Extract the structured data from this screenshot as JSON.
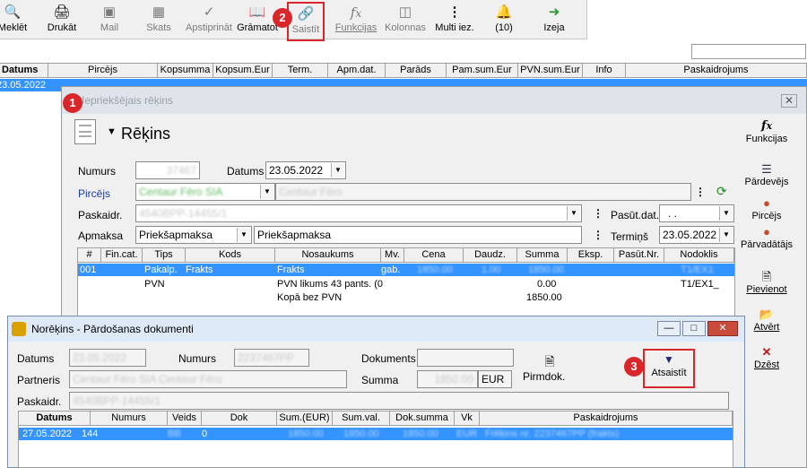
{
  "toolbar": {
    "items": [
      {
        "label": "Meklēt",
        "icon": "search-icon",
        "disabled": false
      },
      {
        "label": "Drukāt",
        "icon": "printer-icon",
        "disabled": false
      },
      {
        "label": "Mail",
        "icon": "mail-icon",
        "disabled": true
      },
      {
        "label": "Skats",
        "icon": "grid-view-icon",
        "disabled": true
      },
      {
        "label": "Apstiprināt",
        "icon": "approve-icon",
        "disabled": true
      },
      {
        "label": "Grāmatot",
        "icon": "book-icon",
        "disabled": false
      },
      {
        "label": "Saistīt",
        "icon": "link-icon",
        "disabled": true
      },
      {
        "label": "Funkcijas",
        "icon": "function-icon",
        "disabled": true
      },
      {
        "label": "Kolonnas",
        "icon": "columns-icon",
        "disabled": true
      },
      {
        "label": "Multi iez.",
        "icon": "more-icon",
        "disabled": false
      },
      {
        "label": "(10)",
        "icon": "alarm-bell-icon",
        "disabled": false
      },
      {
        "label": "Izeja",
        "icon": "exit-icon",
        "disabled": false
      }
    ]
  },
  "annotations": [
    "1",
    "2",
    "3"
  ],
  "main_grid": {
    "columns": [
      "Datums",
      "Pircējs",
      "Kopsumma",
      "Kopsum.Eur",
      "Term.",
      "Apm.dat.",
      "Parāds",
      "Pam.sum.Eur",
      "PVN.sum.Eur",
      "Info",
      "Paskaidrojums"
    ],
    "row": {
      "date": "23.05.2022"
    }
  },
  "invoice_window": {
    "title": "Iepriekšējais rēķins",
    "heading": "Rēķins",
    "functions_label": "Funkcijas",
    "fields": {
      "numurs_label": "Numurs",
      "numurs_value": "37467",
      "datums_label": "Datums",
      "datums_value": "23.05.2022",
      "pircejs_label": "Pircējs",
      "pircejs_code": "Centaur Fēro SIA",
      "pircejs_name": "Centaur Fēro",
      "paskaidr_label": "Paskaidr.",
      "paskaidr_value": "4540BPP-14455/1",
      "pasut_dat_label": "Pasūt.dat.",
      "pasut_dat_value": ". .",
      "apmaksa_label": "Apmaksa",
      "apmaksa_value": "Priekšapmaksa",
      "apmaksa_text": "Priekšapmaksa",
      "termins_label": "Termiņš",
      "termins_value": "23.05.2022"
    },
    "grid": {
      "columns": [
        "#",
        "Fin.cat.",
        "Tips",
        "Kods",
        "Nosaukums",
        "Mv.",
        "Cena",
        "Daudz.",
        "Summa",
        "Eksp.",
        "Pasūt.Nr.",
        "Nodoklis"
      ],
      "rows": [
        {
          "num": "001",
          "fin": "",
          "tips": "Pakalp.",
          "kods": "Frakts",
          "nosaukums": "Frakts",
          "mv": "gab.",
          "cena": "1850.00",
          "daudz": "1.00",
          "summa": "1850.00",
          "eksp": "",
          "pasut": "",
          "nodoklis": "T1/EX1",
          "selected": true
        },
        {
          "num": "",
          "fin": "",
          "tips": "PVN",
          "kods": "",
          "nosaukums": "PVN likums 43 pants. (0",
          "mv": "",
          "cena": "",
          "daudz": "",
          "summa": "0.00",
          "eksp": "",
          "pasut": "",
          "nodoklis": "T1/EX1_",
          "selected": false
        },
        {
          "num": "",
          "fin": "",
          "tips": "",
          "kods": "",
          "nosaukums": "Kopā bez PVN",
          "mv": "",
          "cena": "",
          "daudz": "",
          "summa": "1850.00",
          "eksp": "",
          "pasut": "",
          "nodoklis": "",
          "selected": false
        }
      ]
    },
    "side_panel": [
      {
        "label": "Pārdevējs",
        "icon": "seller-icon"
      },
      {
        "label": "Pircējs",
        "icon": "buyer-icon"
      },
      {
        "label": "Pārvadātājs",
        "icon": "carrier-icon"
      },
      {
        "label": "Pievienot",
        "icon": "add-document-icon"
      },
      {
        "label": "Atvērt",
        "icon": "open-folder-icon"
      },
      {
        "label": "Dzēst",
        "icon": "delete-icon"
      }
    ]
  },
  "nore_window": {
    "title": "Norēķins - Pārdošanas dokumenti",
    "datums_label": "Datums",
    "datums_value": "23.05.2022",
    "numurs_label": "Numurs",
    "numurs_value": "2237467PP",
    "dokuments_label": "Dokuments",
    "dokuments_value": "",
    "partneris_label": "Partneris",
    "partneris_value": "Centaur Fēro SIA  Centaur Fēro",
    "summa_label": "Summa",
    "summa_value": "1850.00",
    "currency": "EUR",
    "pirmdok_label": "Pirmdok.",
    "atsaistit_label": "Atsaistīt",
    "paskaidr_label": "Paskaidr.",
    "paskaidr_value": "4540BPP-14455/1",
    "grid": {
      "columns": [
        "Datums",
        "Numurs",
        "Veids",
        "Dok",
        "Sum.(EUR)",
        "Sum.val.",
        "Dok.summa",
        "Vk",
        "Paskaidrojums"
      ],
      "row": {
        "datums": "27.05.2022",
        "numurs": "144",
        "veids": "BB",
        "dok": "0",
        "sum_eur": "1850.00",
        "sum_val": "1850.00",
        "dok_summa": "1850.00",
        "vk": "EUR",
        "paskaidrojums": "Frēķins nr. 2237467PP (frakts)"
      }
    }
  }
}
